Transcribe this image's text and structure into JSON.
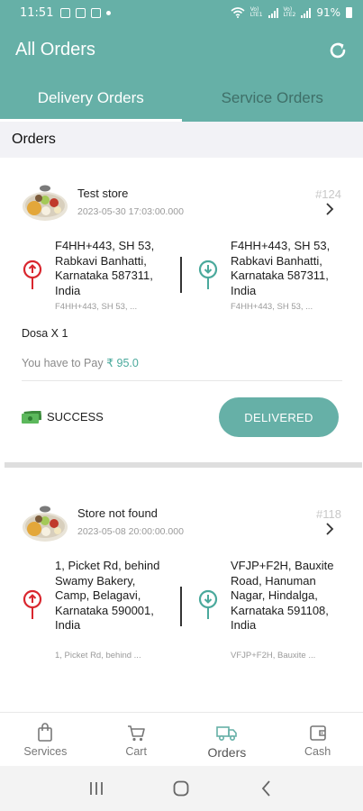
{
  "status_bar": {
    "time": "11:51",
    "network": "Vo) LTE1 Vo) LTE2",
    "battery": "91%"
  },
  "header": {
    "title": "All Orders",
    "tabs": [
      {
        "label": "Delivery Orders",
        "active": true
      },
      {
        "label": "Service Orders",
        "active": false
      }
    ]
  },
  "section_title": "Orders",
  "orders": [
    {
      "store": "Test store",
      "time": "2023-05-30 17:03:00.000",
      "id": "#124",
      "pickup_address": "F4HH+443, SH 53, Rabkavi Banhatti, Karnataka 587311, India",
      "pickup_sub": "F4HH+443, SH 53, ...",
      "drop_address": "F4HH+443, SH 53, Rabkavi Banhatti, Karnataka 587311, India",
      "drop_sub": "F4HH+443, SH 53, ...",
      "item": "Dosa X 1",
      "pay_label": "You have to Pay",
      "pay_amount": "₹ 95.0",
      "status": "SUCCESS",
      "button": "DELIVERED"
    },
    {
      "store": "Store not found",
      "time": "2023-05-08 20:00:00.000",
      "id": "#118",
      "pickup_address": "1, Picket Rd, behind Swamy Bakery, Camp, Belagavi, Karnataka 590001, India",
      "pickup_sub": "1, Picket Rd, behind ...",
      "drop_address": "VFJP+F2H, Bauxite Road, Hanuman Nagar, Hindalga, Karnataka 591108, India",
      "drop_sub": "VFJP+F2H, Bauxite ..."
    }
  ],
  "bottom_nav": [
    {
      "label": "Services",
      "icon": "shopping-bag-icon",
      "active": false
    },
    {
      "label": "Cart",
      "icon": "cart-icon",
      "active": false
    },
    {
      "label": "Orders",
      "icon": "truck-icon",
      "active": true
    },
    {
      "label": "Cash",
      "icon": "wallet-icon",
      "active": false
    }
  ],
  "colors": {
    "primary": "#66b0a7",
    "pickup_pin": "#d9262e",
    "drop_pin": "#4aa99c"
  }
}
